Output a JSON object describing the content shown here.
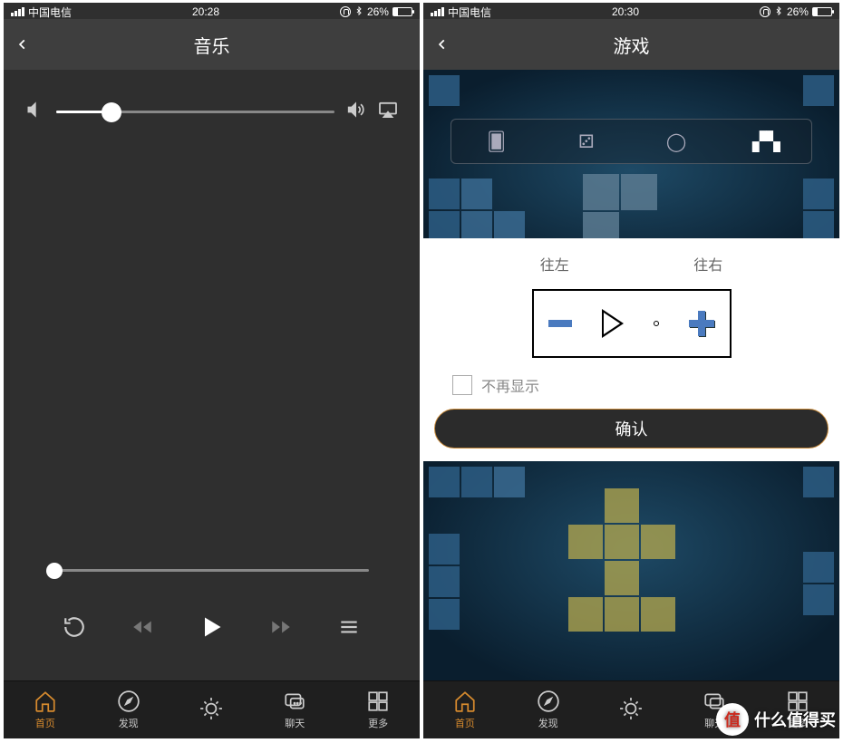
{
  "left": {
    "status": {
      "carrier": "中国电信",
      "time": "20:28",
      "battery_pct": "26%"
    },
    "nav_title": "音乐",
    "volume_pct": 20,
    "progress_pct": 0,
    "tabs": [
      {
        "label": "首页",
        "active": true
      },
      {
        "label": "发现",
        "active": false
      },
      {
        "label": "",
        "active": false
      },
      {
        "label": "聊天",
        "active": false
      },
      {
        "label": "更多",
        "active": false
      }
    ]
  },
  "right": {
    "status": {
      "carrier": "中国电信",
      "time": "20:30",
      "battery_pct": "26%"
    },
    "nav_title": "游戏",
    "direction_labels": {
      "left": "往左",
      "right": "往右"
    },
    "dont_show_again": "不再显示",
    "confirm": "确认",
    "tabs": [
      {
        "label": "首页",
        "active": true
      },
      {
        "label": "发现",
        "active": false
      },
      {
        "label": "",
        "active": false
      },
      {
        "label": "聊天",
        "active": false
      },
      {
        "label": "更多",
        "active": false
      }
    ]
  },
  "watermark": "什么值得买"
}
